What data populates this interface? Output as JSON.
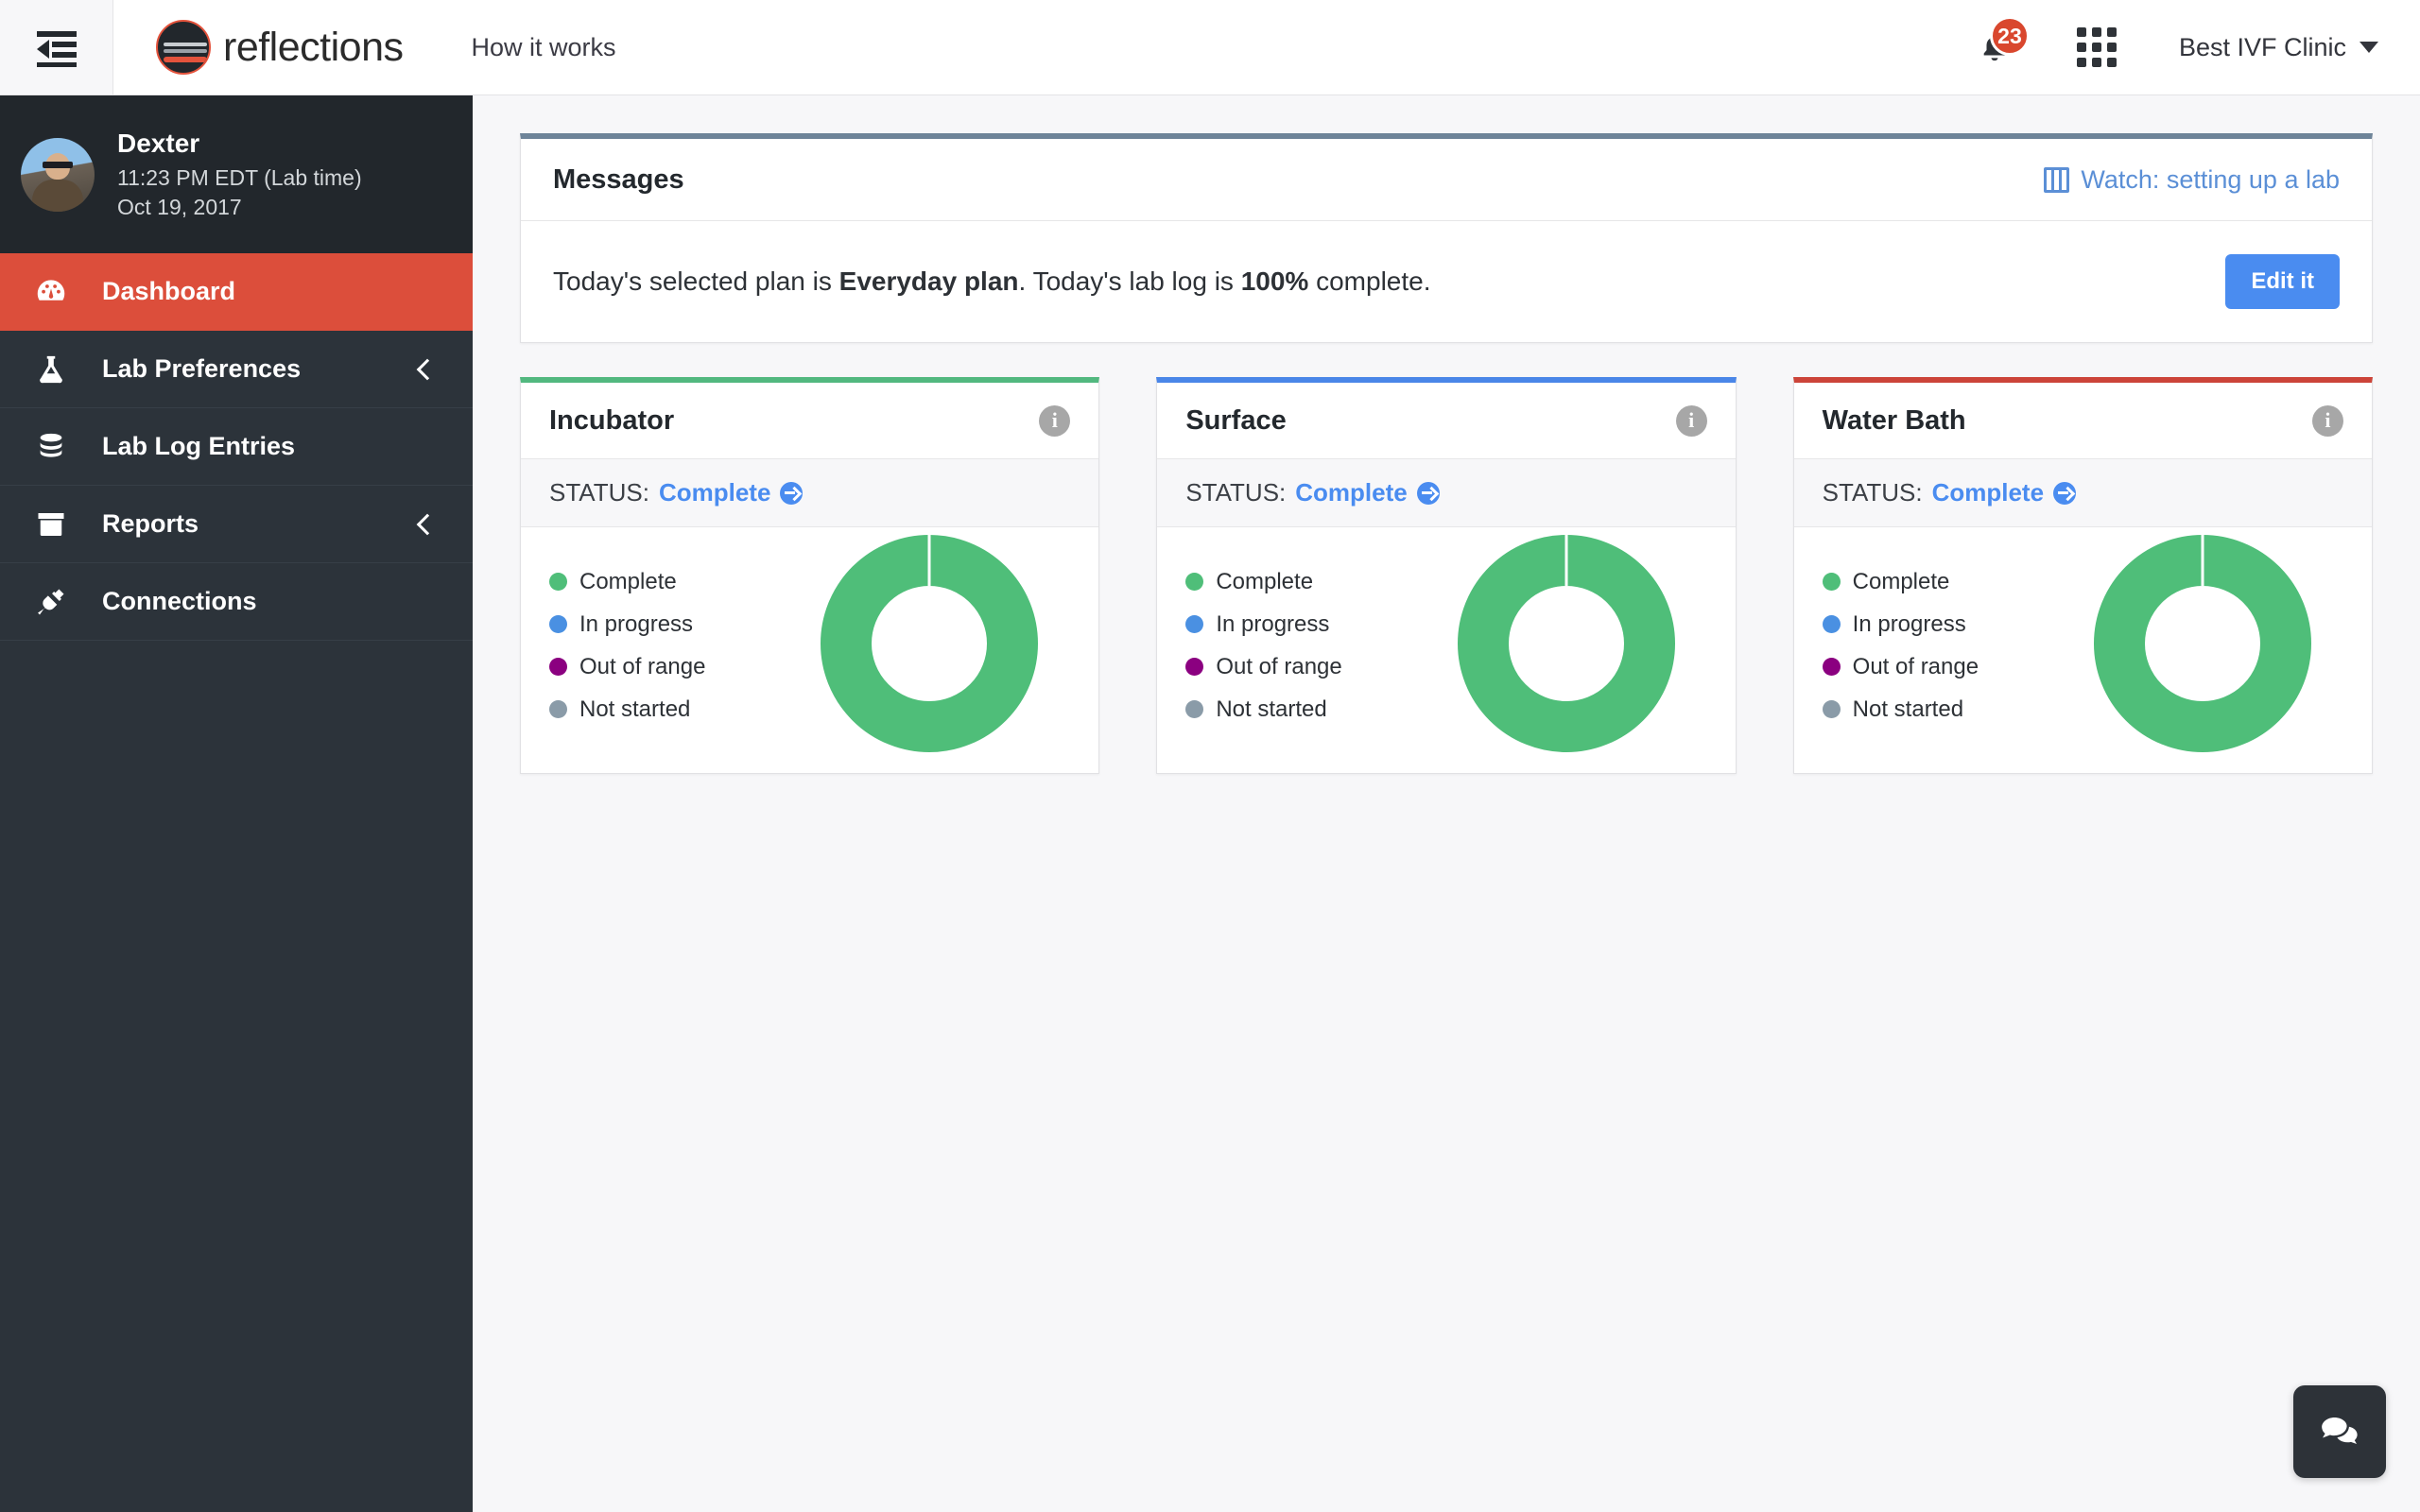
{
  "topbar": {
    "collapse_icon": "sidebar-collapse-icon",
    "brand_name": "reflections",
    "nav_link": "How it works",
    "notification_count": "23",
    "clinic_name": "Best IVF Clinic"
  },
  "sidebar": {
    "user": {
      "name": "Dexter",
      "time": "11:23 PM EDT (Lab time)",
      "date": "Oct 19, 2017"
    },
    "items": [
      {
        "label": "Dashboard",
        "icon": "gauge-icon",
        "active": true,
        "chevron": false
      },
      {
        "label": "Lab Preferences",
        "icon": "flask-icon",
        "active": false,
        "chevron": true
      },
      {
        "label": "Lab Log Entries",
        "icon": "database-icon",
        "active": false,
        "chevron": false
      },
      {
        "label": "Reports",
        "icon": "archive-icon",
        "active": false,
        "chevron": true
      },
      {
        "label": "Connections",
        "icon": "plug-icon",
        "active": false,
        "chevron": false
      }
    ]
  },
  "messages": {
    "title": "Messages",
    "watch_link": "Watch: setting up a lab",
    "body_prefix": "Today's selected plan is ",
    "plan_name": "Everyday plan",
    "body_middle": ". Today's lab log is ",
    "percent": "100%",
    "body_suffix": " complete.",
    "edit_label": "Edit it"
  },
  "status_label": "STATUS:",
  "legend_labels": [
    "Complete",
    "In progress",
    "Out of range",
    "Not started"
  ],
  "colors": {
    "green": "#4FBE79",
    "blue": "#4A90E2",
    "purple": "#8B0080",
    "gray": "#8A9BA8",
    "accent_red": "#dc4e3b",
    "link_blue": "#4a8cf0",
    "panel_border": "#6e8499"
  },
  "cards": [
    {
      "title": "Incubator",
      "top_color": "#52b87f",
      "status_value": "Complete",
      "info_icon": "info-icon",
      "chart_data": {
        "type": "pie",
        "title": "Incubator",
        "categories": [
          "Complete",
          "In progress",
          "Out of range",
          "Not started"
        ],
        "values": [
          100,
          0,
          0,
          0
        ],
        "colors": [
          "#4FBE79",
          "#4A90E2",
          "#8B0080",
          "#8A9BA8"
        ],
        "unit": "%",
        "legend_position": "left",
        "donut": true
      }
    },
    {
      "title": "Surface",
      "top_color": "#4a86e8",
      "status_value": "Complete",
      "info_icon": "info-icon",
      "chart_data": {
        "type": "pie",
        "title": "Surface",
        "categories": [
          "Complete",
          "In progress",
          "Out of range",
          "Not started"
        ],
        "values": [
          100,
          0,
          0,
          0
        ],
        "colors": [
          "#4FBE79",
          "#4A90E2",
          "#8B0080",
          "#8A9BA8"
        ],
        "unit": "%",
        "legend_position": "left",
        "donut": true
      }
    },
    {
      "title": "Water Bath",
      "top_color": "#cc4439",
      "status_value": "Complete",
      "info_icon": "info-icon",
      "chart_data": {
        "type": "pie",
        "title": "Water Bath",
        "categories": [
          "Complete",
          "In progress",
          "Out of range",
          "Not started"
        ],
        "values": [
          100,
          0,
          0,
          0
        ],
        "colors": [
          "#4FBE79",
          "#4A90E2",
          "#8B0080",
          "#8A9BA8"
        ],
        "unit": "%",
        "legend_position": "left",
        "donut": true
      }
    }
  ],
  "chat_button": "chat-bubble-icon"
}
